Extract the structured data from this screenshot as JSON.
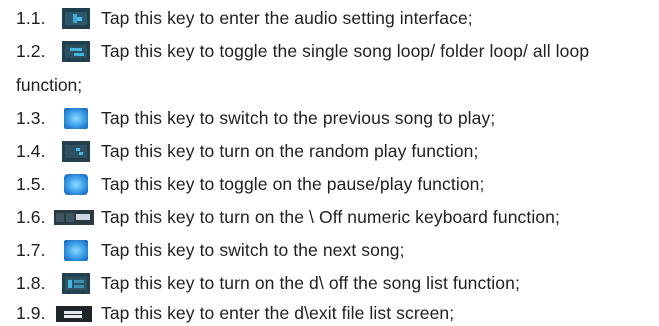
{
  "items": [
    {
      "num": "1.1.",
      "icon": "audio-settings-icon",
      "text": "Tap this key to enter the audio setting interface;"
    },
    {
      "num": "1.2.",
      "icon": "loop-mode-icon",
      "text": "Tap this key to toggle the single song loop/ folder loop/ all loop"
    },
    {
      "num": "1.3.",
      "icon": "previous-song-icon",
      "text": "Tap this key to switch to the previous song to play;"
    },
    {
      "num": "1.4.",
      "icon": "random-play-icon",
      "text": "Tap this key to turn on the random play function;"
    },
    {
      "num": "1.5.",
      "icon": "pause-play-icon",
      "text": "Tap this key to toggle on the pause/play function;"
    },
    {
      "num": "1.6.",
      "icon": "numeric-keyboard-icon",
      "text": "Tap this key to turn on the \\ Off numeric keyboard function;"
    },
    {
      "num": "1.7.",
      "icon": "next-song-icon",
      "text": "Tap this key to switch to the next song;"
    },
    {
      "num": "1.8.",
      "icon": "song-list-icon",
      "text": "Tap this key to turn on the d\\ off the song list function;"
    },
    {
      "num": "1.9.",
      "icon": "file-list-icon",
      "text": "Tap this key to enter the d\\exit file list screen;"
    }
  ],
  "continuation": "function;"
}
